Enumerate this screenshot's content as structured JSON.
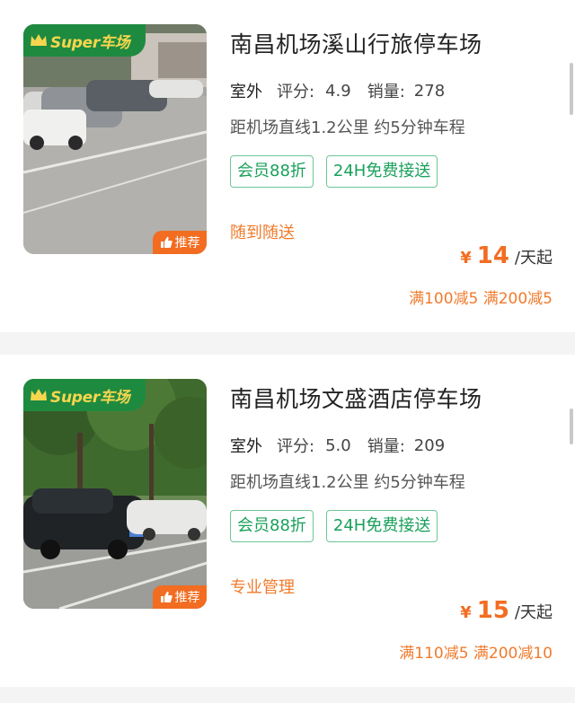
{
  "listings": [
    {
      "badge_brand": "Super车场",
      "recommend_label": "推荐",
      "title": "南昌机场溪山行旅停车场",
      "location_type": "室外",
      "rating_label": "评分:",
      "rating": "4.9",
      "sales_label": "销量:",
      "sales": "278",
      "distance": "距机场直线1.2公里 约5分钟车程",
      "tags": [
        "会员88折",
        "24H免费接送"
      ],
      "feature": "随到随送",
      "price_symbol": "¥",
      "price": "14",
      "price_unit": "/天起",
      "discount": "满100减5 满200减5"
    },
    {
      "badge_brand": "Super车场",
      "recommend_label": "推荐",
      "title": "南昌机场文盛酒店停车场",
      "location_type": "室外",
      "rating_label": "评分:",
      "rating": "5.0",
      "sales_label": "销量:",
      "sales": "209",
      "distance": "距机场直线1.2公里 约5分钟车程",
      "tags": [
        "会员88折",
        "24H免费接送"
      ],
      "feature": "专业管理",
      "price_symbol": "¥",
      "price": "15",
      "price_unit": "/天起",
      "discount": "满110减5 满200减10"
    }
  ],
  "colors": {
    "brand_green": "#1e8a3f",
    "badge_yellow": "#f6d64e",
    "accent_orange": "#f26d21",
    "tag_green": "#19a05b"
  },
  "icons": {
    "crown": "crown-icon",
    "thumb": "thumb-up-icon"
  }
}
